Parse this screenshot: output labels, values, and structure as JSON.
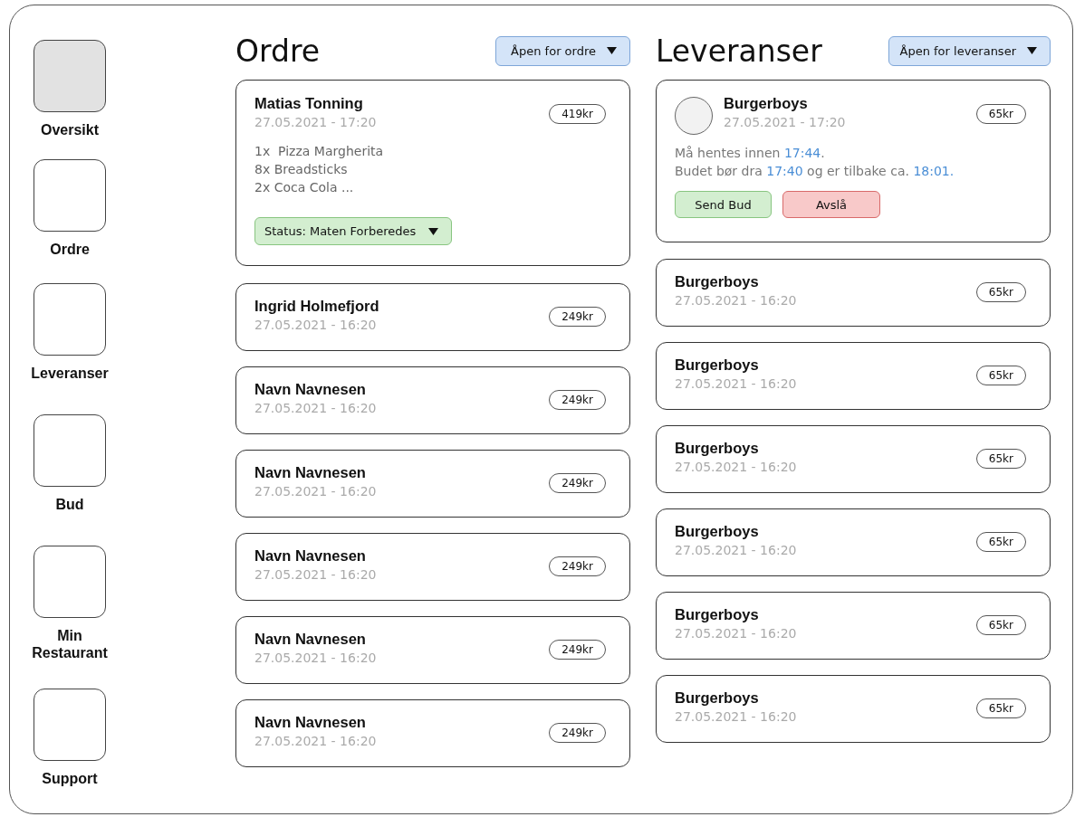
{
  "sidebar": {
    "items": [
      {
        "label": "Oversikt",
        "selected": true
      },
      {
        "label": "Ordre",
        "selected": false
      },
      {
        "label": "Leveranser",
        "selected": false
      },
      {
        "label": "Bud",
        "selected": false
      },
      {
        "label": "Min Restaurant",
        "selected": false
      },
      {
        "label": "Support",
        "selected": false
      }
    ]
  },
  "orders": {
    "title": "Ordre",
    "filter": "Åpen for ordre",
    "items": [
      {
        "kind": "detailed",
        "name": "Matias Tonning",
        "time": "27.05.2021 - 17:20",
        "price": "419kr",
        "lines": [
          "1x  Pizza Margherita",
          "8x Breadsticks",
          "2x Coca Cola ..."
        ],
        "status": "Status: Maten Forberedes"
      },
      {
        "kind": "compact",
        "name": "Ingrid Holmefjord",
        "time": "27.05.2021 - 16:20",
        "price": "249kr"
      },
      {
        "kind": "compact",
        "name": "Navn Navnesen",
        "time": "27.05.2021 - 16:20",
        "price": "249kr"
      },
      {
        "kind": "compact",
        "name": "Navn Navnesen",
        "time": "27.05.2021 - 16:20",
        "price": "249kr"
      },
      {
        "kind": "compact",
        "name": "Navn Navnesen",
        "time": "27.05.2021 - 16:20",
        "price": "249kr"
      },
      {
        "kind": "compact",
        "name": "Navn Navnesen",
        "time": "27.05.2021 - 16:20",
        "price": "249kr"
      },
      {
        "kind": "compact",
        "name": "Navn Navnesen",
        "time": "27.05.2021 - 16:20",
        "price": "249kr"
      }
    ]
  },
  "deliveries": {
    "title": "Leveranser",
    "filter": "Åpen for leveranser",
    "items": [
      {
        "kind": "detailed",
        "name": "Burgerboys",
        "time": "27.05.2021 - 17:20",
        "price": "65kr",
        "messages": [
          [
            {
              "text": "Må hentes innen "
            },
            {
              "text": "17:44",
              "highlight": true
            },
            {
              "text": "."
            }
          ],
          [
            {
              "text": "Budet bør dra "
            },
            {
              "text": "17:40",
              "highlight": true
            },
            {
              "text": " og er tilbake ca. "
            },
            {
              "text": "18:01.",
              "highlight": true
            }
          ]
        ],
        "buttons": [
          {
            "label": "Send Bud",
            "kind": "accept"
          },
          {
            "label": "Avslå",
            "kind": "reject"
          }
        ]
      },
      {
        "kind": "compact",
        "name": "Burgerboys",
        "time": "27.05.2021 - 16:20",
        "price": "65kr"
      },
      {
        "kind": "compact",
        "name": "Burgerboys",
        "time": "27.05.2021 - 16:20",
        "price": "65kr"
      },
      {
        "kind": "compact",
        "name": "Burgerboys",
        "time": "27.05.2021 - 16:20",
        "price": "65kr"
      },
      {
        "kind": "compact",
        "name": "Burgerboys",
        "time": "27.05.2021 - 16:20",
        "price": "65kr"
      },
      {
        "kind": "compact",
        "name": "Burgerboys",
        "time": "27.05.2021 - 16:20",
        "price": "65kr"
      },
      {
        "kind": "compact",
        "name": "Burgerboys",
        "time": "27.05.2021 - 16:20",
        "price": "65kr"
      }
    ]
  }
}
